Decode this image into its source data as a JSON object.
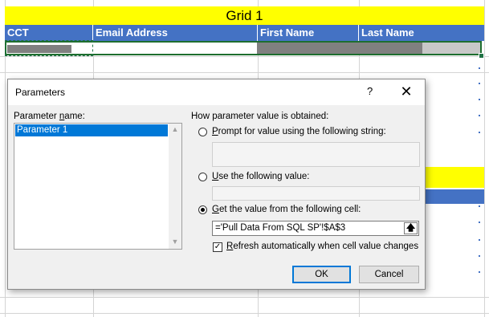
{
  "sheet": {
    "grid_title": "Grid 1",
    "columns": [
      "CCT",
      "Email Address",
      "First Name",
      "Last Name"
    ],
    "colors": {
      "yellow": "#ffff00",
      "header_blue": "#4472c4",
      "selection": "#217346"
    }
  },
  "dialog": {
    "title": "Parameters",
    "help_label": "?",
    "close_label": "✕",
    "param_name_label": "Parameter name:",
    "parameters": [
      "Parameter 1"
    ],
    "how_label": "How parameter value is obtained:",
    "option_prompt": "Prompt for value using the following string:",
    "option_use": "Use the following value:",
    "option_cell": "Get the value from the following cell:",
    "cell_ref": "='Pull Data From SQL SP'!$A$3",
    "refresh_label": "Refresh automatically when cell value changes",
    "refresh_checked": true,
    "selected_option": "cell",
    "ok_label": "OK",
    "cancel_label": "Cancel"
  }
}
